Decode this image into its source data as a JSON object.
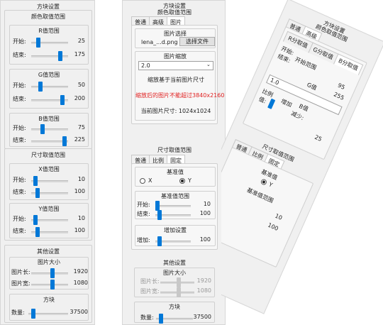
{
  "panel1": {
    "title": "方块设置",
    "color_group": "颜色取值范围",
    "r": {
      "title": "R值范围",
      "start_label": "开始:",
      "start": "25",
      "end_label": "结束:",
      "end": "175"
    },
    "g": {
      "title": "G值范围",
      "start_label": "开始:",
      "start": "50",
      "end_label": "结束:",
      "end": "200"
    },
    "b": {
      "title": "B值范围",
      "start_label": "开始:",
      "start": "75",
      "end_label": "结束:",
      "end": "225"
    },
    "size_group": "尺寸取值范围",
    "x": {
      "title": "X值范围",
      "start_label": "开始:",
      "start": "10",
      "end_label": "结束:",
      "end": "100"
    },
    "y": {
      "title": "Y值范围",
      "start_label": "开始:",
      "start": "10",
      "end_label": "结束:",
      "end": "100"
    },
    "other_group": "其他设置",
    "image_size": {
      "title": "图片大小",
      "width_label": "图片长:",
      "width": "1920",
      "height_label": "图片宽:",
      "height": "1080"
    },
    "block": {
      "title": "方块",
      "count_label": "数量:",
      "count": "37500"
    }
  },
  "panel2": {
    "title": "方块设置",
    "color_group": "颜色取值范围",
    "tabs": [
      "普通",
      "高级",
      "图片"
    ],
    "image_select": {
      "title": "图片选择",
      "file": "lena_...d.png",
      "button": "选择文件"
    },
    "image_scale": {
      "title": "图片缩放",
      "combo": "2.0",
      "desc": "缩放基于当前图片尺寸",
      "warning": "缩放后的图片不能超过3840x2160",
      "current": "当前图片尺寸: 1024x1024"
    },
    "size_group": "尺寸取值范围",
    "size_tabs": [
      "普通",
      "比例",
      "固定"
    ],
    "base_value": {
      "title": "基准值",
      "x": "X",
      "y": "Y"
    },
    "base_range": {
      "title": "基准值范围",
      "start_label": "开始:",
      "start": "10",
      "end_label": "结束:",
      "end": "100"
    },
    "increment": {
      "title": "增加设置",
      "add_label": "增加:",
      "add": "100"
    },
    "other_group": "其他设置",
    "image_size": {
      "title": "图片大小",
      "width_label": "图片长:",
      "width": "1920",
      "height_label": "图片宽:",
      "height": "1080"
    },
    "block": {
      "title": "方块",
      "count_label": "数量:",
      "count": "37500"
    }
  },
  "panel3": {
    "title": "方块设置",
    "color_group": "颜色取值范围",
    "tabs": [
      "普通",
      "高级"
    ],
    "subtabs": [
      "R分取值",
      "G分取值",
      "B分取值"
    ],
    "start_label": "开始:",
    "end_label": "结束:",
    "start_end_range": "开始范围",
    "val1": "95",
    "g_label": "G值",
    "g_val": "255",
    "combo": "1.0",
    "ratio_label": "比例",
    "ratio_value_label": "值:",
    "add_label": "增加",
    "decrease_label": "减少:",
    "b_label": "B值",
    "val2": "25",
    "size_group": "尺寸取值范围",
    "size_tabs": [
      "普通",
      "比例",
      "固定"
    ],
    "base_value": "基准值",
    "y_label": "Y",
    "base_range": "基准值范围",
    "v10": "10",
    "v100": "100"
  }
}
